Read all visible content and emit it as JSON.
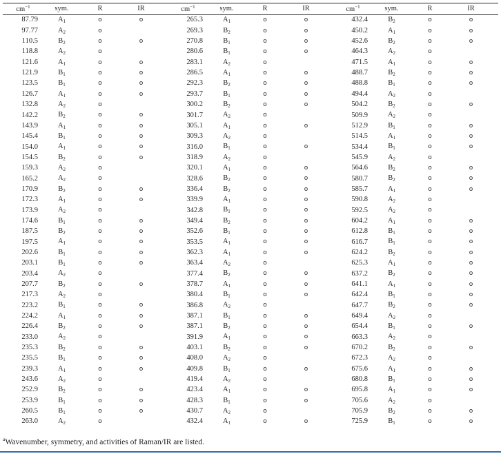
{
  "header": {
    "wavenumber_label": "cm",
    "wavenumber_exp": "−1",
    "symmetry_label": "sym.",
    "raman_label": "R",
    "ir_label": "IR"
  },
  "mark_glyph": "o",
  "columns": [
    [
      [
        "87.79",
        "A",
        "1",
        "o",
        "o"
      ],
      [
        "97.77",
        "A",
        "2",
        "o",
        ""
      ],
      [
        "110.5",
        "B",
        "2",
        "o",
        "o"
      ],
      [
        "118.8",
        "A",
        "2",
        "o",
        ""
      ],
      [
        "121.6",
        "A",
        "1",
        "o",
        "o"
      ],
      [
        "121.9",
        "B",
        "1",
        "o",
        "o"
      ],
      [
        "123.5",
        "B",
        "1",
        "o",
        "o"
      ],
      [
        "126.7",
        "A",
        "1",
        "o",
        "o"
      ],
      [
        "132.8",
        "A",
        "2",
        "o",
        ""
      ],
      [
        "142.2",
        "B",
        "2",
        "o",
        "o"
      ],
      [
        "143.9",
        "A",
        "1",
        "o",
        "o"
      ],
      [
        "145.4",
        "B",
        "1",
        "o",
        "o"
      ],
      [
        "154.0",
        "A",
        "1",
        "o",
        "o"
      ],
      [
        "154.5",
        "B",
        "2",
        "o",
        "o"
      ],
      [
        "159.3",
        "A",
        "2",
        "o",
        ""
      ],
      [
        "165.2",
        "A",
        "2",
        "o",
        ""
      ],
      [
        "170.9",
        "B",
        "2",
        "o",
        "o"
      ],
      [
        "172.3",
        "A",
        "1",
        "o",
        "o"
      ],
      [
        "173.9",
        "A",
        "2",
        "o",
        ""
      ],
      [
        "174.6",
        "B",
        "1",
        "o",
        "o"
      ],
      [
        "187.5",
        "B",
        "2",
        "o",
        "o"
      ],
      [
        "197.5",
        "A",
        "1",
        "o",
        "o"
      ],
      [
        "202.6",
        "B",
        "1",
        "o",
        "o"
      ],
      [
        "203.1",
        "B",
        "1",
        "o",
        "o"
      ],
      [
        "203.4",
        "A",
        "2",
        "o",
        ""
      ],
      [
        "207.7",
        "B",
        "2",
        "o",
        "o"
      ],
      [
        "217.3",
        "A",
        "2",
        "o",
        ""
      ],
      [
        "223.2",
        "B",
        "1",
        "o",
        "o"
      ],
      [
        "224.2",
        "A",
        "1",
        "o",
        "o"
      ],
      [
        "226.4",
        "B",
        "2",
        "o",
        "o"
      ],
      [
        "233.0",
        "A",
        "2",
        "o",
        ""
      ],
      [
        "235.3",
        "B",
        "2",
        "o",
        "o"
      ],
      [
        "235.5",
        "B",
        "1",
        "o",
        "o"
      ],
      [
        "239.3",
        "A",
        "1",
        "o",
        "o"
      ],
      [
        "243.6",
        "A",
        "2",
        "o",
        ""
      ],
      [
        "252.9",
        "B",
        "2",
        "o",
        "o"
      ],
      [
        "253.9",
        "B",
        "1",
        "o",
        "o"
      ],
      [
        "260.5",
        "B",
        "1",
        "o",
        "o"
      ],
      [
        "263.0",
        "A",
        "2",
        "o",
        ""
      ]
    ],
    [
      [
        "265.3",
        "A",
        "1",
        "o",
        "o"
      ],
      [
        "269.3",
        "B",
        "2",
        "o",
        "o"
      ],
      [
        "270.8",
        "B",
        "1",
        "o",
        "o"
      ],
      [
        "280.6",
        "B",
        "1",
        "o",
        "o"
      ],
      [
        "283.1",
        "A",
        "2",
        "o",
        ""
      ],
      [
        "286.5",
        "A",
        "1",
        "o",
        "o"
      ],
      [
        "292.3",
        "B",
        "2",
        "o",
        "o"
      ],
      [
        "293.7",
        "B",
        "1",
        "o",
        "o"
      ],
      [
        "300.2",
        "B",
        "2",
        "o",
        "o"
      ],
      [
        "301.7",
        "A",
        "2",
        "o",
        ""
      ],
      [
        "305.1",
        "A",
        "1",
        "o",
        "o"
      ],
      [
        "309.3",
        "A",
        "2",
        "o",
        ""
      ],
      [
        "316.0",
        "B",
        "1",
        "o",
        "o"
      ],
      [
        "318.9",
        "A",
        "2",
        "o",
        ""
      ],
      [
        "320.1",
        "A",
        "1",
        "o",
        "o"
      ],
      [
        "328.6",
        "B",
        "2",
        "o",
        "o"
      ],
      [
        "336.4",
        "B",
        "2",
        "o",
        "o"
      ],
      [
        "339.9",
        "A",
        "1",
        "o",
        "o"
      ],
      [
        "342.8",
        "B",
        "1",
        "o",
        "o"
      ],
      [
        "349.4",
        "B",
        "2",
        "o",
        "o"
      ],
      [
        "352.6",
        "B",
        "1",
        "o",
        "o"
      ],
      [
        "353.5",
        "A",
        "1",
        "o",
        "o"
      ],
      [
        "362.3",
        "A",
        "1",
        "o",
        "o"
      ],
      [
        "363.4",
        "A",
        "2",
        "o",
        ""
      ],
      [
        "377.4",
        "B",
        "2",
        "o",
        "o"
      ],
      [
        "378.7",
        "A",
        "1",
        "o",
        "o"
      ],
      [
        "380.4",
        "B",
        "1",
        "o",
        "o"
      ],
      [
        "386.8",
        "A",
        "2",
        "o",
        ""
      ],
      [
        "387.1",
        "B",
        "1",
        "o",
        "o"
      ],
      [
        "387.1",
        "B",
        "2",
        "o",
        "o"
      ],
      [
        "391.9",
        "A",
        "1",
        "o",
        "o"
      ],
      [
        "403.1",
        "B",
        "2",
        "o",
        "o"
      ],
      [
        "408.0",
        "A",
        "2",
        "o",
        ""
      ],
      [
        "409.8",
        "B",
        "1",
        "o",
        "o"
      ],
      [
        "419.4",
        "A",
        "2",
        "o",
        ""
      ],
      [
        "423.4",
        "A",
        "1",
        "o",
        "o"
      ],
      [
        "428.3",
        "B",
        "1",
        "o",
        "o"
      ],
      [
        "430.7",
        "A",
        "2",
        "o",
        ""
      ],
      [
        "432.4",
        "A",
        "1",
        "o",
        "o"
      ]
    ],
    [
      [
        "432.4",
        "B",
        "2",
        "o",
        "o"
      ],
      [
        "450.2",
        "A",
        "1",
        "o",
        "o"
      ],
      [
        "452.6",
        "B",
        "2",
        "o",
        "o"
      ],
      [
        "464.3",
        "A",
        "2",
        "o",
        ""
      ],
      [
        "471.5",
        "A",
        "1",
        "o",
        "o"
      ],
      [
        "488.7",
        "B",
        "2",
        "o",
        "o"
      ],
      [
        "488.8",
        "B",
        "1",
        "o",
        "o"
      ],
      [
        "494.4",
        "A",
        "2",
        "o",
        ""
      ],
      [
        "504.2",
        "B",
        "2",
        "o",
        "o"
      ],
      [
        "509.9",
        "A",
        "2",
        "o",
        ""
      ],
      [
        "512.9",
        "B",
        "1",
        "o",
        "o"
      ],
      [
        "514.5",
        "A",
        "1",
        "o",
        "o"
      ],
      [
        "534.4",
        "B",
        "1",
        "o",
        "o"
      ],
      [
        "545.9",
        "A",
        "2",
        "o",
        ""
      ],
      [
        "564.6",
        "B",
        "2",
        "o",
        "o"
      ],
      [
        "580.7",
        "B",
        "2",
        "o",
        "o"
      ],
      [
        "585.7",
        "A",
        "1",
        "o",
        "o"
      ],
      [
        "590.8",
        "A",
        "2",
        "o",
        ""
      ],
      [
        "592.5",
        "A",
        "2",
        "o",
        ""
      ],
      [
        "604.2",
        "A",
        "1",
        "o",
        "o"
      ],
      [
        "612.8",
        "B",
        "1",
        "o",
        "o"
      ],
      [
        "616.7",
        "B",
        "1",
        "o",
        "o"
      ],
      [
        "624.2",
        "B",
        "2",
        "o",
        "o"
      ],
      [
        "625.3",
        "A",
        "1",
        "o",
        "o"
      ],
      [
        "637.2",
        "B",
        "2",
        "o",
        "o"
      ],
      [
        "641.1",
        "A",
        "1",
        "o",
        "o"
      ],
      [
        "642.4",
        "B",
        "1",
        "o",
        "o"
      ],
      [
        "647.7",
        "B",
        "2",
        "o",
        "o"
      ],
      [
        "649.4",
        "A",
        "2",
        "o",
        ""
      ],
      [
        "654.4",
        "B",
        "1",
        "o",
        "o"
      ],
      [
        "663.3",
        "A",
        "2",
        "o",
        ""
      ],
      [
        "670.2",
        "B",
        "2",
        "o",
        "o"
      ],
      [
        "672.3",
        "A",
        "2",
        "o",
        ""
      ],
      [
        "675.6",
        "A",
        "1",
        "o",
        "o"
      ],
      [
        "680.8",
        "B",
        "1",
        "o",
        "o"
      ],
      [
        "695.8",
        "A",
        "1",
        "o",
        "o"
      ],
      [
        "705.6",
        "A",
        "2",
        "o",
        ""
      ],
      [
        "705.9",
        "B",
        "2",
        "o",
        "o"
      ],
      [
        "725.9",
        "B",
        "1",
        "o",
        "o"
      ]
    ]
  ],
  "footnote": {
    "marker": "a",
    "text": "Wavenumber, symmetry, and activities of Raman/IR are listed."
  }
}
